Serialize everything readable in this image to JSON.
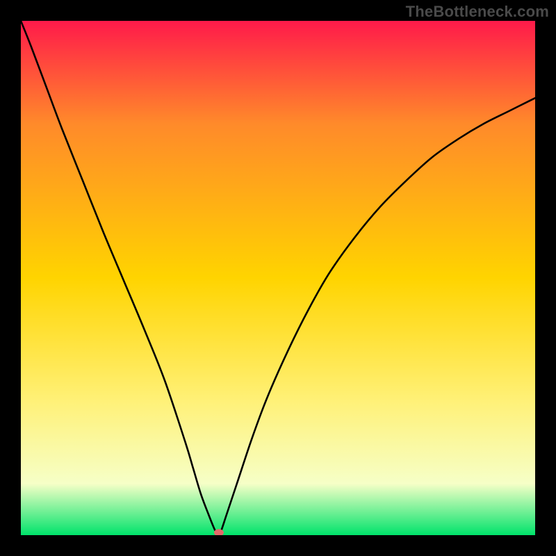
{
  "attribution": "TheBottleneck.com",
  "chart_data": {
    "type": "line",
    "title": "",
    "xlabel": "",
    "ylabel": "",
    "xlim": [
      0,
      100
    ],
    "ylim": [
      0,
      100
    ],
    "grid": false,
    "background_gradient": {
      "top": "#ff1a4a",
      "upper_mid": "#ff8a2a",
      "mid": "#ffd400",
      "lower_mid": "#fff178",
      "lower": "#f6ffc7",
      "bottom": "#00e36b"
    },
    "series": [
      {
        "name": "bottleneck-curve",
        "x": [
          0,
          2,
          5,
          8,
          12,
          16,
          20,
          24,
          28,
          32,
          33.5,
          35,
          36.5,
          37.5,
          38,
          38.5,
          39,
          40,
          42,
          45,
          48,
          52,
          56,
          60,
          65,
          70,
          75,
          80,
          85,
          90,
          95,
          100
        ],
        "y": [
          100,
          95,
          87,
          79,
          69,
          59,
          49.5,
          40,
          30,
          18,
          13,
          8,
          4,
          1.5,
          0.5,
          0,
          1,
          4,
          10,
          19,
          27,
          36,
          44,
          51,
          58,
          64,
          69,
          73.5,
          77,
          80,
          82.5,
          85
        ]
      }
    ],
    "markers": [
      {
        "name": "min-point",
        "x": 38.5,
        "y": 0.5,
        "color": "#e46a6a",
        "rx": 7,
        "ry": 5
      }
    ]
  }
}
